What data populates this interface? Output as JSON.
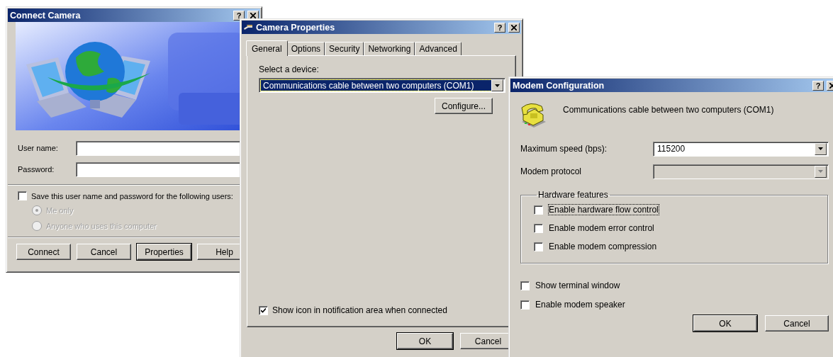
{
  "connect_window": {
    "title": "Connect Camera",
    "help": "?",
    "fields": [
      {
        "label": "User name:"
      },
      {
        "label": "Password:"
      }
    ],
    "save_checkbox": {
      "label": "Save this user name and password for the following users:",
      "checked": false
    },
    "radios": [
      {
        "label": "Me only",
        "selected": true,
        "disabled": true
      },
      {
        "label": "Anyone who uses this computer",
        "selected": false,
        "disabled": true
      }
    ],
    "buttons": [
      {
        "label": "Connect",
        "default": false
      },
      {
        "label": "Cancel",
        "default": false
      },
      {
        "label": "Properties",
        "default": true
      },
      {
        "label": "Help",
        "default": false
      }
    ]
  },
  "properties_window": {
    "title": "Camera Properties",
    "help": "?",
    "tabs": [
      {
        "label": "General",
        "selected": true
      },
      {
        "label": "Options",
        "selected": false
      },
      {
        "label": "Security",
        "selected": false
      },
      {
        "label": "Networking",
        "selected": false
      },
      {
        "label": "Advanced",
        "selected": false
      }
    ],
    "device_label": "Select a device:",
    "device": "Communications cable between two computers (COM1)",
    "configure": "Configure...",
    "notify": {
      "label": "Show icon in notification area when connected",
      "checked": true
    },
    "buttons": [
      {
        "label": "OK",
        "default": true
      },
      {
        "label": "Cancel",
        "default": false
      }
    ]
  },
  "modem_window": {
    "title": "Modem Configuration",
    "help": "?",
    "device": "Communications cable between two computers (COM1)",
    "speed_label": "Maximum speed (bps):",
    "speed": "115200",
    "protocol_label": "Modem protocol",
    "protocol_disabled": true,
    "group_title": "Hardware features",
    "features": [
      {
        "label": "Enable hardware flow control",
        "checked": false,
        "focused": true
      },
      {
        "label": "Enable modem error control",
        "checked": false,
        "focused": false
      },
      {
        "label": "Enable modem compression",
        "checked": false,
        "focused": false
      }
    ],
    "options": [
      {
        "label": "Show terminal window",
        "checked": false
      },
      {
        "label": "Enable modem speaker",
        "checked": false
      }
    ],
    "buttons": [
      {
        "label": "OK",
        "default": true
      },
      {
        "label": "Cancel",
        "default": false
      }
    ]
  }
}
